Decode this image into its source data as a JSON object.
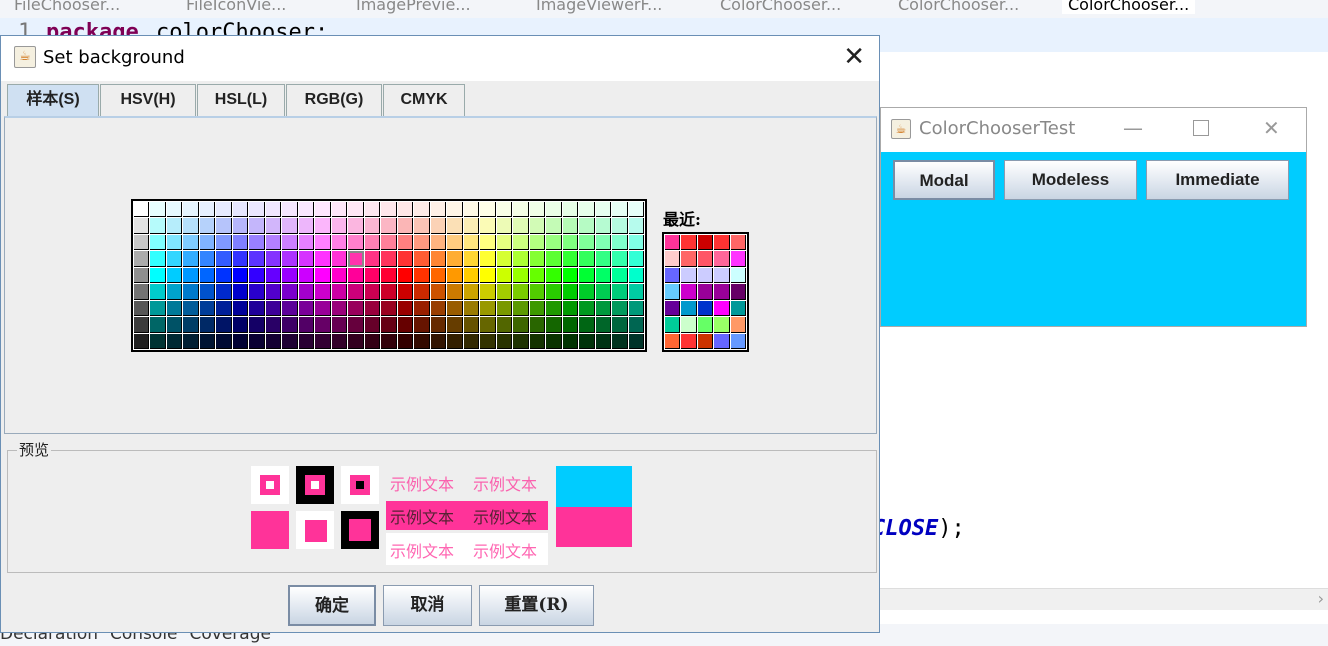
{
  "ide": {
    "tabs": [
      "FileChooser...",
      "FileIconVie...",
      "ImagePrevie...",
      "ImageViewerF...",
      "ColorChooser...",
      "ColorChooser...",
      "ColorChooser..."
    ],
    "line_number": "1",
    "code_keyword": "package",
    "code_rest": "colorChooser;",
    "code_const": "CLOSE",
    "code_tail": ");",
    "bottom_tabs": [
      "Declaration",
      "Console",
      "Coverage"
    ]
  },
  "test_window": {
    "title": "ColorChooserTest",
    "background": "#00ccff",
    "buttons": [
      "Modal",
      "Modeless",
      "Immediate"
    ]
  },
  "dialog": {
    "title": "Set background",
    "tabs": [
      {
        "label": "样本(S)",
        "selected": true
      },
      {
        "label": "HSV(H)",
        "selected": false
      },
      {
        "label": "HSL(L)",
        "selected": false
      },
      {
        "label": "RGB(G)",
        "selected": false
      },
      {
        "label": "CMYK",
        "selected": false
      }
    ],
    "recent_label": "最近:",
    "recent_colors": [
      "#ff3399",
      "#ff3333",
      "#cc0000",
      "#ff3333",
      "#ff6666",
      "#ffcccc",
      "#ff6666",
      "#ff5566",
      "#ff6699",
      "#ff33ff",
      "#6666ff",
      "#ccccff",
      "#ccccff",
      "#ccccff",
      "#ccffff",
      "#66ccff",
      "#cc00cc",
      "#990099",
      "#990099",
      "#660066",
      "#660099",
      "#0099cc",
      "#0033cc",
      "#ff00ff",
      "#009999",
      "#00cc99",
      "#ccffcc",
      "#66ff66",
      "#99ff66",
      "#ff9966",
      "#ff6633",
      "#ff3333",
      "#cc3300",
      "#6666ff",
      "#6699ff"
    ],
    "preview_label": "预览",
    "sample_text": "示例文本",
    "selected_color": "#ff3399",
    "previous_color": "#00ccff",
    "buttons": {
      "ok": "确定",
      "cancel": "取消",
      "reset": "重置(R)"
    }
  }
}
